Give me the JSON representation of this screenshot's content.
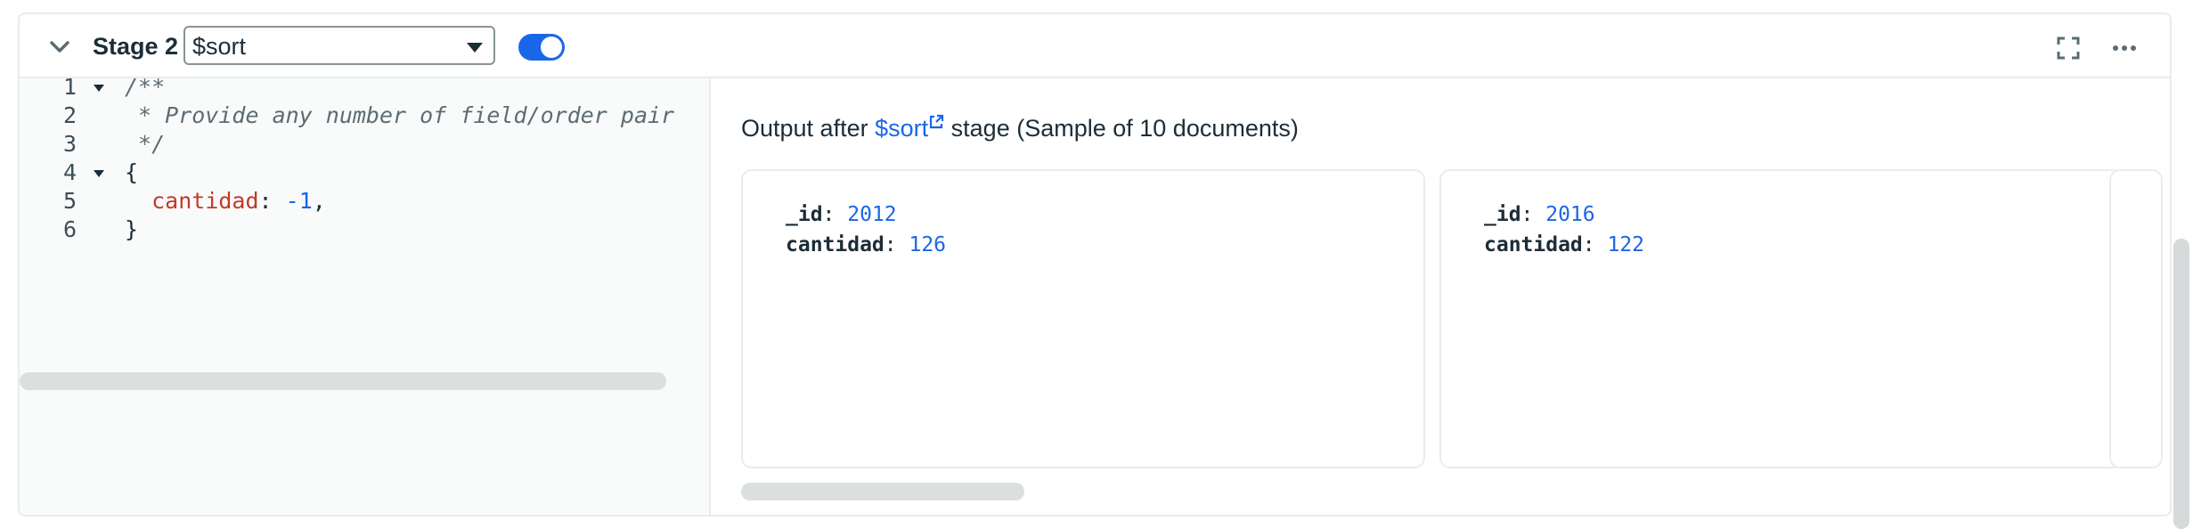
{
  "stage": {
    "title": "Stage 2",
    "operator": "$sort",
    "enabled": true
  },
  "editor": {
    "lines": [
      {
        "num": "1",
        "parts": [
          {
            "t": "/**",
            "c": "comment"
          }
        ]
      },
      {
        "num": "2",
        "parts": [
          {
            "t": " * Provide any number of field/order pair",
            "c": "comment"
          }
        ]
      },
      {
        "num": "3",
        "parts": [
          {
            "t": " */",
            "c": "comment"
          }
        ]
      },
      {
        "num": "4",
        "parts": [
          {
            "t": "{",
            "c": "plain"
          }
        ]
      },
      {
        "num": "5",
        "parts": [
          {
            "t": "  ",
            "c": "plain"
          },
          {
            "t": "cantidad",
            "c": "key"
          },
          {
            "t": ": ",
            "c": "plain"
          },
          {
            "t": "-1",
            "c": "num"
          },
          {
            "t": ",",
            "c": "plain"
          }
        ]
      },
      {
        "num": "6",
        "parts": [
          {
            "t": "}",
            "c": "plain"
          }
        ]
      }
    ]
  },
  "output": {
    "prefix": "Output after",
    "link": "$sort",
    "suffix": "stage (Sample of 10 documents)",
    "documents": [
      {
        "fields": [
          {
            "key": "_id",
            "value": "2012"
          },
          {
            "key": "cantidad",
            "value": "126"
          }
        ]
      },
      {
        "fields": [
          {
            "key": "_id",
            "value": "2016"
          },
          {
            "key": "cantidad",
            "value": "122"
          }
        ]
      }
    ]
  },
  "icons": {
    "collapse": "chevron-down-icon",
    "dropdown": "caret-down-icon",
    "external": "external-link-icon",
    "fullscreen": "fullscreen-icon",
    "more": "more-options-icon"
  },
  "colors": {
    "accent": "#1a66e8",
    "key": "#c23a2a",
    "border": "#e8edeb"
  }
}
